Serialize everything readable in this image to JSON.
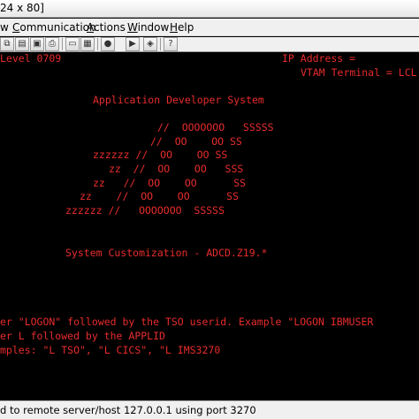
{
  "window": {
    "title": "24 x 80]"
  },
  "menu": {
    "items": [
      {
        "label": "w",
        "mnemonic": ""
      },
      {
        "label": "Communication",
        "mnemonic": "C"
      },
      {
        "label": "Actions",
        "mnemonic": "A"
      },
      {
        "label": "Window",
        "mnemonic": "W"
      },
      {
        "label": "Help",
        "mnemonic": "H"
      }
    ]
  },
  "toolbar": {
    "buttons": [
      {
        "icon": "copy-icon",
        "glyph": "⧉"
      },
      {
        "icon": "paste-icon",
        "glyph": "▤"
      },
      {
        "icon": "disk-icon",
        "glyph": "▣"
      },
      {
        "icon": "print-icon",
        "glyph": "⎙"
      },
      {
        "icon": "screen-icon",
        "glyph": "▭"
      },
      {
        "icon": "monitor-icon",
        "glyph": "▦"
      },
      {
        "icon": "record-icon",
        "glyph": "●"
      },
      {
        "icon": "play-icon",
        "glyph": "▶"
      },
      {
        "icon": "macro-icon",
        "glyph": "◈"
      },
      {
        "icon": "help-icon",
        "glyph": "?"
      }
    ]
  },
  "terminal": {
    "color": "#e82c2c",
    "lines": [
      "Level 0709",
      "IP Address =",
      "VTAM Terminal = LCL",
      "Application Developer System",
      "//  OOOOOOO   SSSSS",
      "//  OO    OO SS",
      "zzzzzz //  OO    OO SS",
      "zz  //  OO    OO   SSS",
      "zz   //  OO    OO      SS",
      "zz    //  OO    OO      SS",
      "zzzzzz //   OOOOOOO  SSSSS",
      "System Customization - ADCD.Z19.*",
      "er \"LOGON\" followed by the TSO userid. Example \"LOGON IBMUSER",
      "er L followed by the APPLID",
      "mples: \"L TSO\", \"L CICS\", \"L IMS3270"
    ]
  },
  "status": {
    "text": "d to remote server/host 127.0.0.1 using port 3270"
  }
}
